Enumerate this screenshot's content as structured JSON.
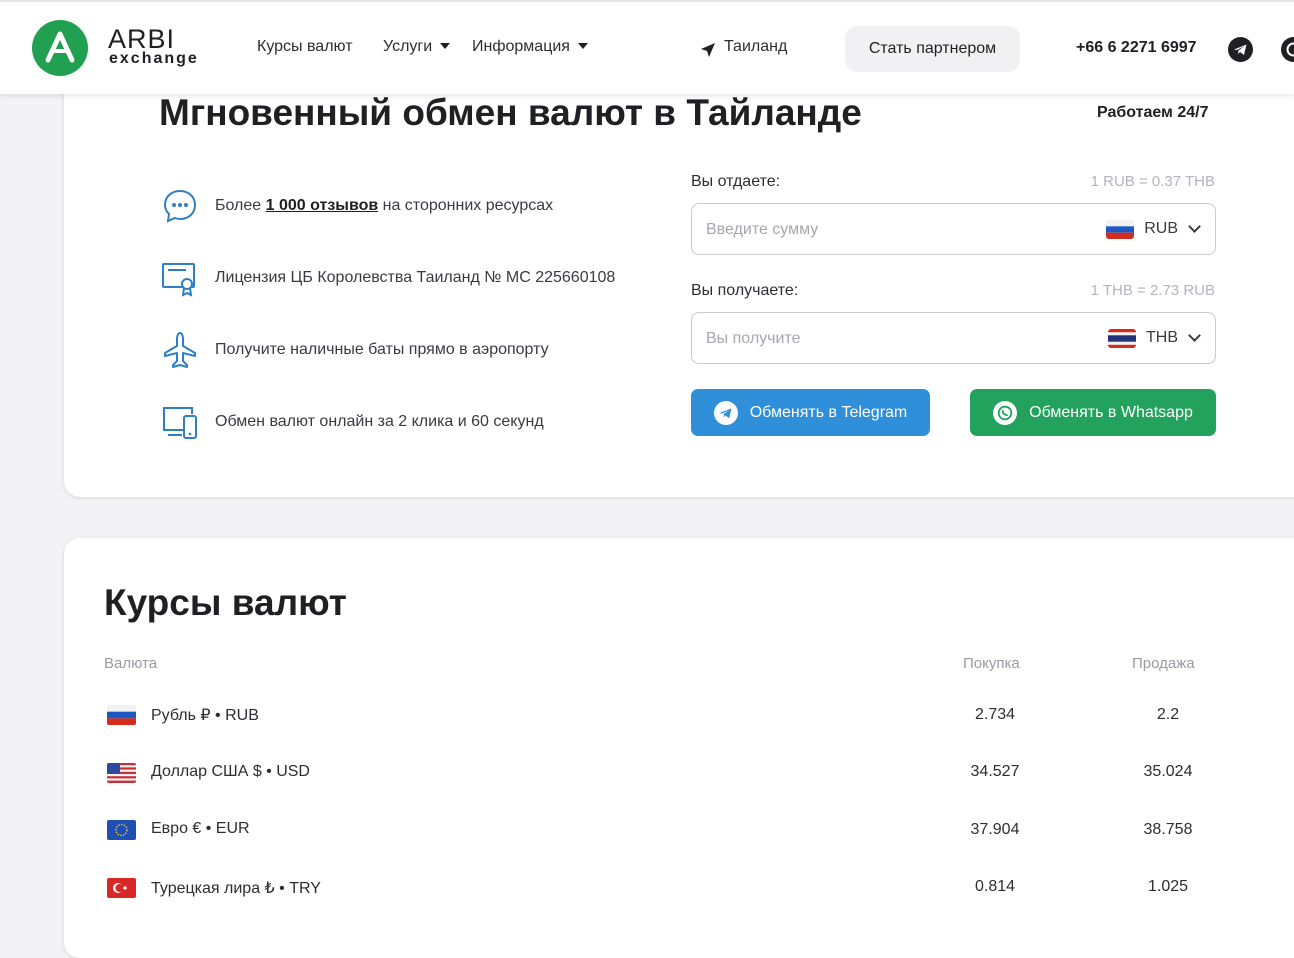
{
  "header": {
    "logo_brand": "ARBI",
    "logo_sub": "exchange",
    "nav": [
      {
        "label": "Курсы валют"
      },
      {
        "label": "Услуги"
      },
      {
        "label": "Информация"
      }
    ],
    "location": "Таиланд",
    "partner_button": "Стать партнером",
    "phone": "+66 6 2271 6997"
  },
  "hero": {
    "title": "Мгновенный обмен валют в Тайланде",
    "works": "Работаем 24/7",
    "features": [
      {
        "icon": "chat-bubble-icon",
        "prefix": "Более ",
        "link": "1 000 отзывов",
        "suffix": " на сторонних ресурсах"
      },
      {
        "icon": "certificate-icon",
        "text": "Лицензия ЦБ Королевства Таиланд № MC 225660108"
      },
      {
        "icon": "airplane-icon",
        "text": "Получите наличные баты прямо в аэропорту"
      },
      {
        "icon": "devices-icon",
        "text": "Обмен валют онлайн за 2 клика и 60 секунд"
      }
    ]
  },
  "exchange": {
    "give_label": "Вы отдаете:",
    "give_rate": "1 RUB = 0.37 THB",
    "give_placeholder": "Введите сумму",
    "give_currency": "RUB",
    "get_label": "Вы получаете:",
    "get_rate": "1 THB = 2.73 RUB",
    "get_placeholder": "Вы получите",
    "get_currency": "THB",
    "telegram_button": "Обменять в Telegram",
    "whatsapp_button": "Обменять в Whatsapp"
  },
  "rates": {
    "title": "Курсы валют",
    "col_currency": "Валюта",
    "col_buy": "Покупка",
    "col_sell": "Продажа",
    "rows": [
      {
        "name": "Рубль ₽ • RUB",
        "buy": "2.734",
        "sell": "2.2"
      },
      {
        "name": "Доллар США $ • USD",
        "buy": "34.527",
        "sell": "35.024"
      },
      {
        "name": "Евро € • EUR",
        "buy": "37.904",
        "sell": "38.758"
      },
      {
        "name": "Турецкая лира ₺ • TRY",
        "buy": "0.814",
        "sell": "1.025"
      }
    ]
  },
  "colors": {
    "brand_green": "#21a052",
    "telegram_blue": "#2f8fd8",
    "whatsapp_green": "#22a25c"
  }
}
